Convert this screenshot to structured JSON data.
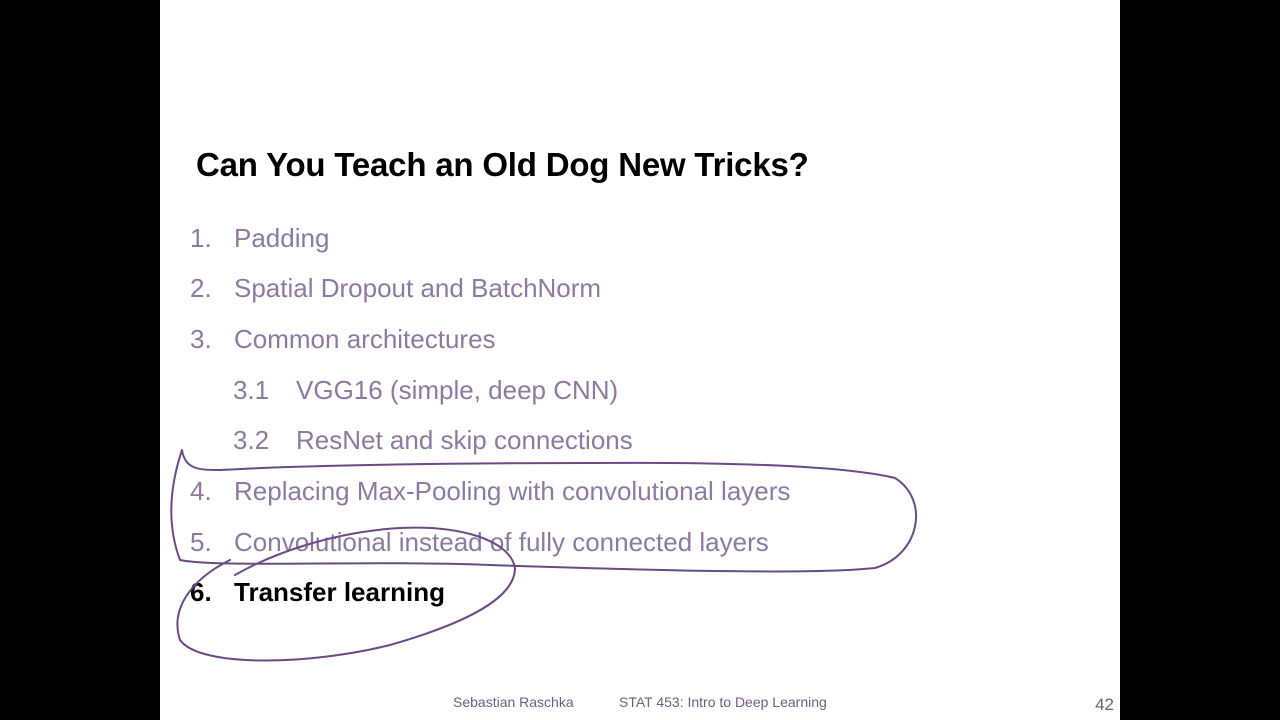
{
  "slide": {
    "title": "Can You Teach an Old Dog New Tricks?",
    "items": [
      {
        "num": "1.",
        "label": "Padding"
      },
      {
        "num": "2.",
        "label": "Spatial Dropout and BatchNorm"
      },
      {
        "num": "3.",
        "label": "Common architectures"
      },
      {
        "num": "3.1",
        "label": "VGG16 (simple, deep CNN)"
      },
      {
        "num": "3.2",
        "label": "ResNet and skip connections"
      },
      {
        "num": "4.",
        "label": "Replacing Max-Pooling with convolutional layers"
      },
      {
        "num": "5.",
        "label": "Convolutional instead of fully connected layers"
      },
      {
        "num": "6.",
        "label": "Transfer learning"
      }
    ],
    "footer": {
      "author": "Sebastian Raschka",
      "course": "STAT 453: Intro to Deep Learning",
      "page": "42"
    }
  },
  "colors": {
    "inactive_text": "#8e7aa0",
    "active_text": "#000000",
    "annotation_ink": "#6b4a86"
  }
}
